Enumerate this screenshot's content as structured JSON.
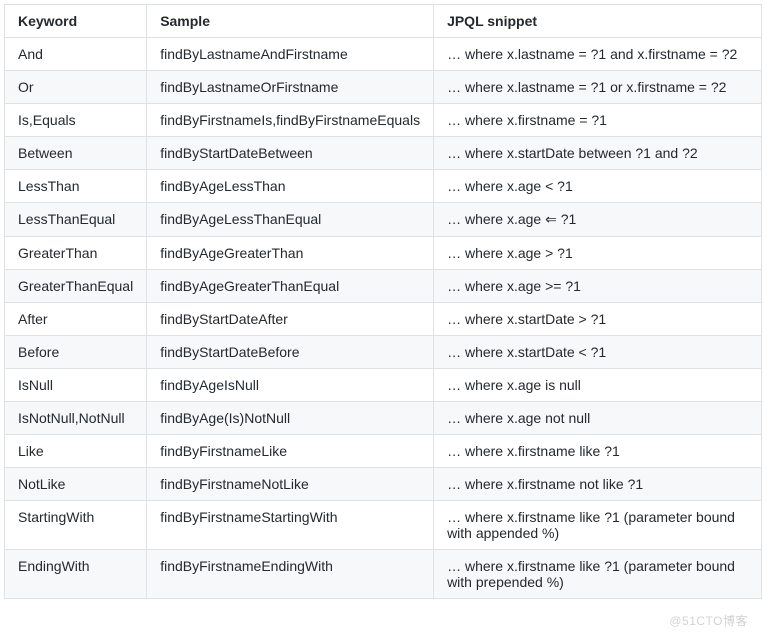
{
  "chart_data": {
    "type": "table",
    "headers": [
      "Keyword",
      "Sample",
      "JPQL snippet"
    ],
    "rows": [
      {
        "keyword": "And",
        "sample": "findByLastnameAndFirstname",
        "jpql": "… where x.lastname = ?1 and x.firstname = ?2"
      },
      {
        "keyword": "Or",
        "sample": "findByLastnameOrFirstname",
        "jpql": "… where x.lastname = ?1 or x.firstname = ?2"
      },
      {
        "keyword": "Is,Equals",
        "sample": "findByFirstnameIs,findByFirstnameEquals",
        "jpql": "… where x.firstname = ?1"
      },
      {
        "keyword": "Between",
        "sample": "findByStartDateBetween",
        "jpql": "… where x.startDate between ?1 and ?2"
      },
      {
        "keyword": "LessThan",
        "sample": "findByAgeLessThan",
        "jpql": "… where x.age < ?1"
      },
      {
        "keyword": "LessThanEqual",
        "sample": "findByAgeLessThanEqual",
        "jpql": "… where x.age ⇐ ?1"
      },
      {
        "keyword": "GreaterThan",
        "sample": "findByAgeGreaterThan",
        "jpql": "… where x.age > ?1"
      },
      {
        "keyword": "GreaterThanEqual",
        "sample": "findByAgeGreaterThanEqual",
        "jpql": "… where x.age >= ?1"
      },
      {
        "keyword": "After",
        "sample": "findByStartDateAfter",
        "jpql": "… where x.startDate > ?1"
      },
      {
        "keyword": "Before",
        "sample": "findByStartDateBefore",
        "jpql": "… where x.startDate < ?1"
      },
      {
        "keyword": "IsNull",
        "sample": "findByAgeIsNull",
        "jpql": "… where x.age is null"
      },
      {
        "keyword": "IsNotNull,NotNull",
        "sample": "findByAge(Is)NotNull",
        "jpql": "… where x.age not null"
      },
      {
        "keyword": "Like",
        "sample": "findByFirstnameLike",
        "jpql": "… where x.firstname like ?1"
      },
      {
        "keyword": "NotLike",
        "sample": "findByFirstnameNotLike",
        "jpql": "… where x.firstname not like ?1"
      },
      {
        "keyword": "StartingWith",
        "sample": "findByFirstnameStartingWith",
        "jpql": "… where x.firstname like ?1 (parameter bound with appended %)"
      },
      {
        "keyword": "EndingWith",
        "sample": "findByFirstnameEndingWith",
        "jpql": "… where x.firstname like ?1 (parameter bound with prepended %)"
      }
    ]
  },
  "watermark": "@51CTO博客"
}
